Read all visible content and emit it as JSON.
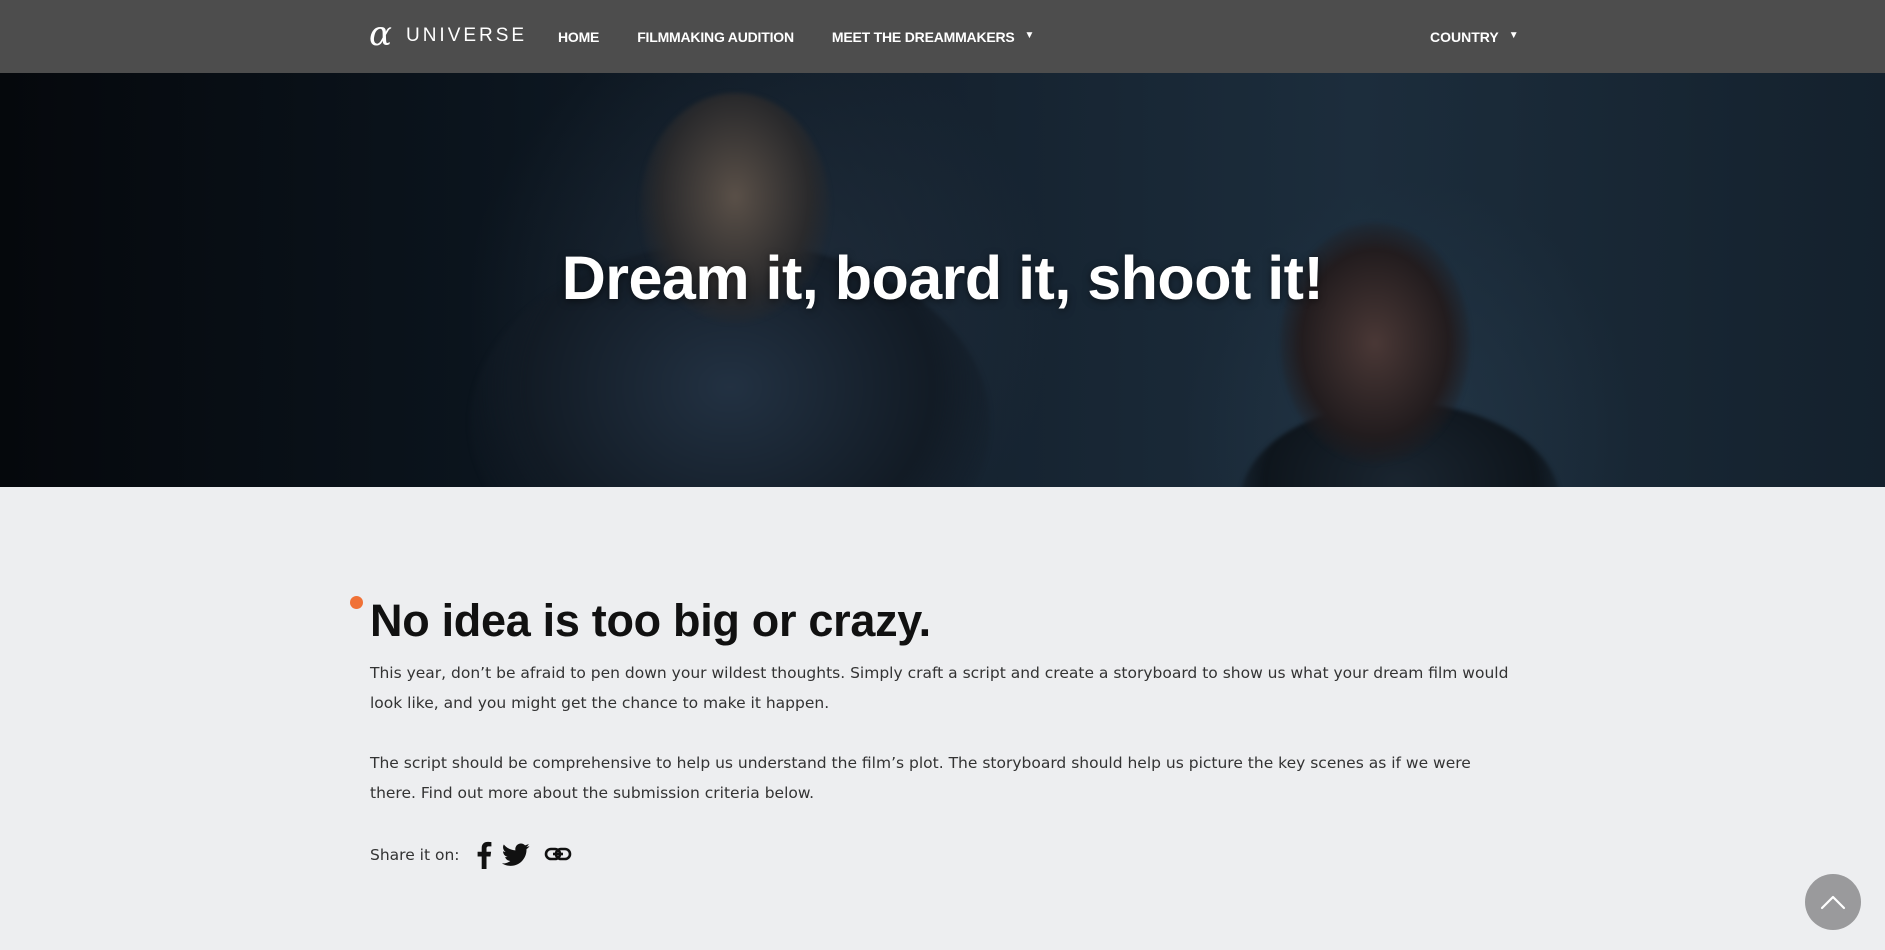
{
  "nav": {
    "brand_symbol": "α",
    "brand_word": "UNIVERSE",
    "links": [
      {
        "label": "HOME"
      },
      {
        "label": "FILMMAKING AUDITION"
      },
      {
        "label": "MEET THE DREAMMAKERS",
        "caret": "▼"
      }
    ],
    "country": {
      "label": "COUNTRY",
      "caret": "▼"
    }
  },
  "hero": {
    "title": "Dream it, board it, shoot it!"
  },
  "main": {
    "heading": "No idea is too big or crazy.",
    "paragraphs": [
      "This year, don’t be afraid to pen down your wildest thoughts. Simply craft a script and create a storyboard to show us what your dream film would look like, and you might get the chance to make it happen.",
      "The script should be comprehensive to help us understand the film’s plot. The storyboard should help us picture the key scenes as if we were there. Find out more about the submission criteria below."
    ],
    "share": {
      "label": "Share it on:",
      "icons": [
        "facebook-icon",
        "twitter-icon",
        "link-icon"
      ]
    }
  },
  "colors": {
    "nav_bg": "#4d4d4d",
    "page_bg": "#edeef0",
    "accent_dot": "#f07136",
    "back_to_top_bg": "#9a9a9c"
  },
  "back_to_top": {
    "icon": "chevron-up-icon"
  }
}
